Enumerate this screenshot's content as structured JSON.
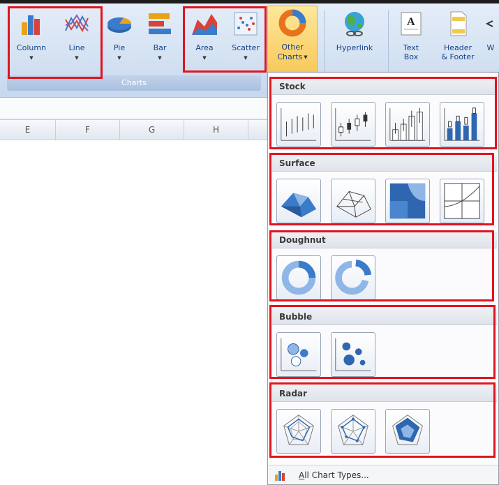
{
  "ribbon": {
    "buttons": [
      {
        "label": "Column"
      },
      {
        "label": "Line"
      },
      {
        "label": "Pie"
      },
      {
        "label": "Bar"
      },
      {
        "label": "Area"
      },
      {
        "label": "Scatter"
      },
      {
        "label_line1": "Other",
        "label_line2": "Charts"
      },
      {
        "label": "Hyperlink"
      },
      {
        "label_line1": "Text",
        "label_line2": "Box"
      },
      {
        "label_line1": "Header",
        "label_line2": "& Footer"
      },
      {
        "label": "W"
      }
    ],
    "group_label": "Charts"
  },
  "sheet": {
    "columns": [
      "E",
      "F",
      "G",
      "H"
    ]
  },
  "dropdown": {
    "sections": [
      {
        "title": "Stock"
      },
      {
        "title": "Surface"
      },
      {
        "title": "Doughnut"
      },
      {
        "title": "Bubble"
      },
      {
        "title": "Radar"
      }
    ],
    "footer_label_underlined": "A",
    "footer_label_rest": "ll Chart Types..."
  },
  "colors": {
    "highlight_red": "#e0141e",
    "ribbon_text": "#15428b",
    "other_charts_bg": "#f8c95c"
  }
}
